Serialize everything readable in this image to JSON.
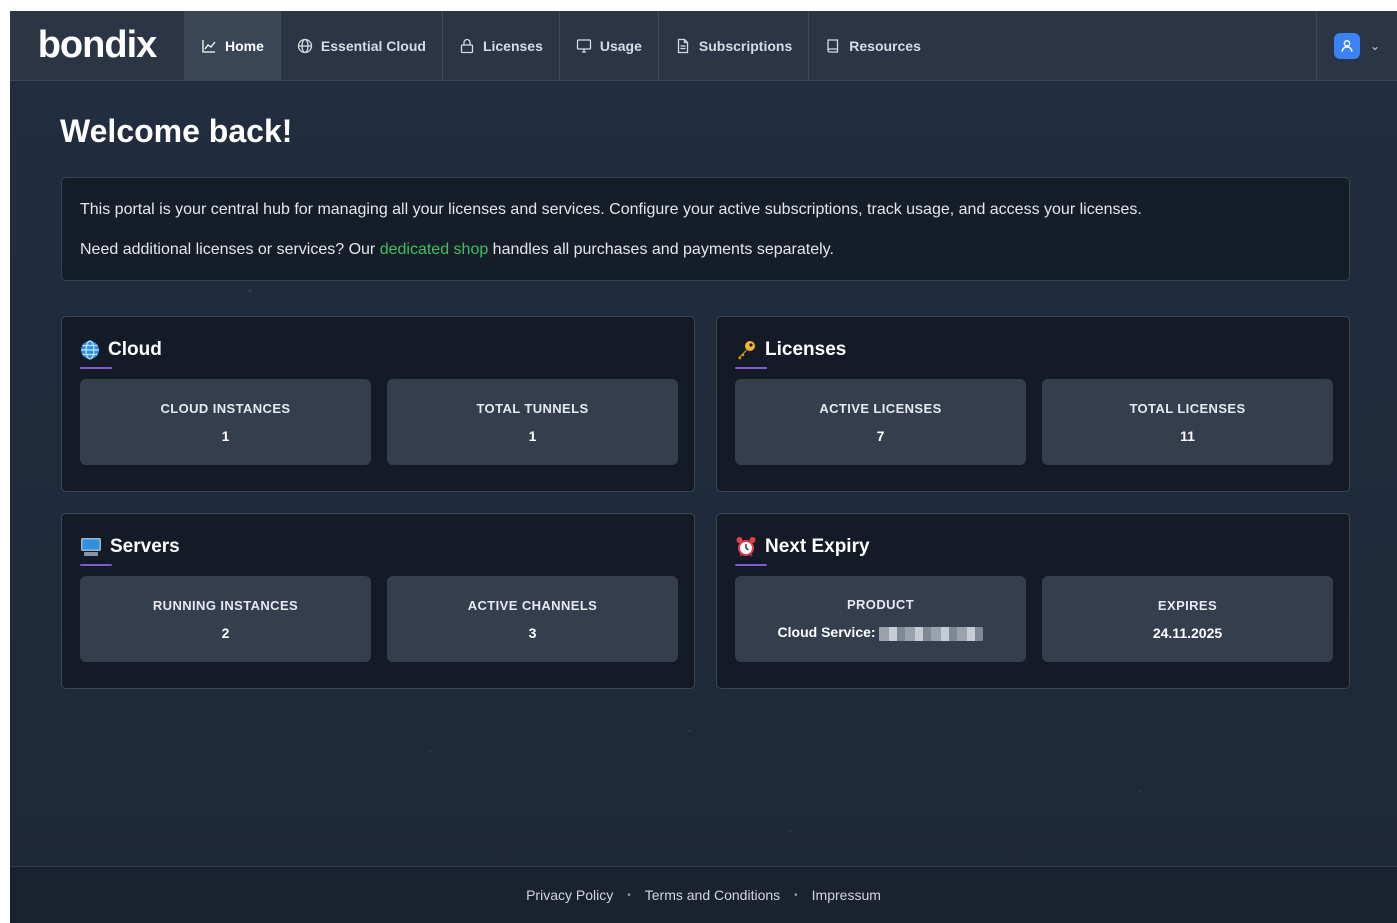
{
  "nav": {
    "logo": "bondix",
    "items": [
      {
        "label": "Home",
        "icon": "chart-line-icon",
        "active": true
      },
      {
        "label": "Essential Cloud",
        "icon": "globe-icon"
      },
      {
        "label": "Licenses",
        "icon": "lock-icon"
      },
      {
        "label": "Usage",
        "icon": "monitor-icon"
      },
      {
        "label": "Subscriptions",
        "icon": "document-icon"
      },
      {
        "label": "Resources",
        "icon": "book-icon"
      }
    ],
    "user_icon": "user-icon"
  },
  "main": {
    "title": "Welcome back!",
    "intro_line1": "This portal is your central hub for managing all your licenses and services. Configure your active subscriptions, track usage, and access your licenses.",
    "intro_line2_before": "Need additional licenses or services? Our ",
    "intro_link": "dedicated shop",
    "intro_line2_after": " handles all purchases and payments separately."
  },
  "cards": {
    "cloud": {
      "title": "Cloud",
      "icon": "globe-emoji-icon",
      "stat1_label": "CLOUD INSTANCES",
      "stat1_value": "1",
      "stat2_label": "TOTAL TUNNELS",
      "stat2_value": "1"
    },
    "licenses": {
      "title": "Licenses",
      "icon": "key-emoji-icon",
      "stat1_label": "ACTIVE LICENSES",
      "stat1_value": "7",
      "stat2_label": "TOTAL LICENSES",
      "stat2_value": "11"
    },
    "servers": {
      "title": "Servers",
      "icon": "computer-emoji-icon",
      "stat1_label": "RUNNING INSTANCES",
      "stat1_value": "2",
      "stat2_label": "ACTIVE CHANNELS",
      "stat2_value": "3"
    },
    "expiry": {
      "title": "Next Expiry",
      "icon": "alarm-clock-emoji-icon",
      "stat1_label": "PRODUCT",
      "stat1_value": "Cloud Service:",
      "stat2_label": "EXPIRES",
      "stat2_value": "24.11.2025"
    }
  },
  "footer": {
    "privacy": "Privacy Policy",
    "terms": "Terms and Conditions",
    "impressum": "Impressum",
    "separator": "•"
  },
  "colors": {
    "accent_link": "#3fbf5f",
    "underline": "#7c5cd6",
    "avatar": "#3b82f6"
  }
}
